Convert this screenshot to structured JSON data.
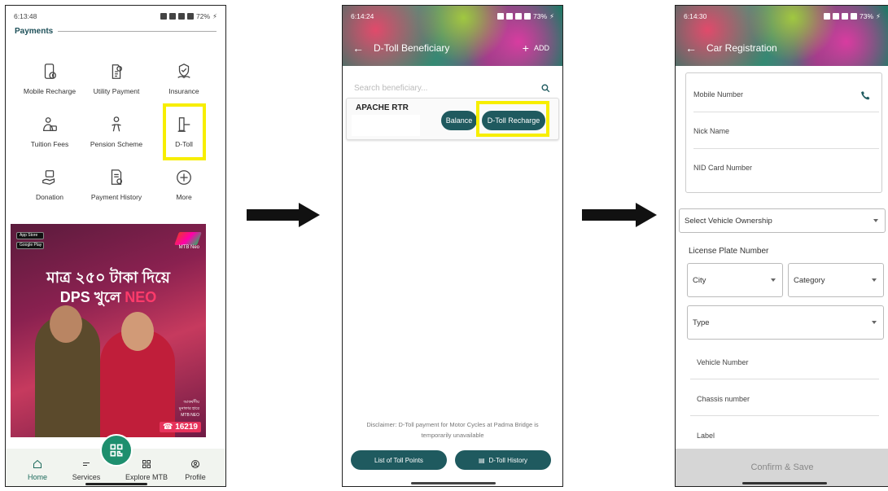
{
  "screen1": {
    "status_time": "6:13:48",
    "status_battery": "72%",
    "section_title": "Payments",
    "items": [
      {
        "label": "Mobile Recharge",
        "icon": "mobile-recharge-icon"
      },
      {
        "label": "Utility Payment",
        "icon": "utility-payment-icon"
      },
      {
        "label": "Insurance",
        "icon": "insurance-icon"
      },
      {
        "label": "Tuition Fees",
        "icon": "tuition-fees-icon"
      },
      {
        "label": "Pension Scheme",
        "icon": "pension-scheme-icon"
      },
      {
        "label": "D-Toll",
        "icon": "d-toll-icon"
      },
      {
        "label": "Donation",
        "icon": "donation-icon"
      },
      {
        "label": "Payment History",
        "icon": "payment-history-icon"
      },
      {
        "label": "More",
        "icon": "plus-circle-icon"
      }
    ],
    "banner": {
      "app_store": "App Store",
      "google_play": "Google Play",
      "brand": "MTB Neo",
      "line1": "মাত্র ২৫০ টাকা দিয়ে",
      "line2_prefix": "DPS খুলে ",
      "line2_highlight": "NEO",
      "hotline": "16219",
      "offer": "আকর্ষণীয় মুনাফার হারে MTB NEO"
    },
    "nav": [
      {
        "label": "Home",
        "icon": "home-icon"
      },
      {
        "label": "Services",
        "icon": "services-icon"
      },
      {
        "label": "Explore MTB",
        "icon": "explore-icon"
      },
      {
        "label": "Profile",
        "icon": "profile-icon"
      }
    ]
  },
  "screen2": {
    "status_time": "6:14:24",
    "status_battery": "73%",
    "title": "D-Toll Beneficiary",
    "add_label": "ADD",
    "search_placeholder": "Search beneficiary...",
    "beneficiary_name": "APACHE RTR",
    "balance_label": "Balance",
    "recharge_label": "D-Toll Recharge",
    "disclaimer": "Disclaimer: D-Toll payment for Motor Cycles at Padma Bridge is temporarily unavailable",
    "toll_points_label": "List of Toll Points",
    "history_label": "D-Toll History"
  },
  "screen3": {
    "status_time": "6:14:30",
    "status_battery": "73%",
    "title": "Car Registration",
    "mobile_number": "Mobile Number",
    "nick_name": "Nick Name",
    "nid_card": "NID Card Number",
    "vehicle_ownership": "Select Vehicle Ownership",
    "license_plate": "License Plate Number",
    "city": "City",
    "category": "Category",
    "type": "Type",
    "vehicle_number": "Vehicle Number",
    "chassis_number": "Chassis number",
    "label": "Label",
    "confirm": "Confirm & Save"
  },
  "colors": {
    "highlight": "#f7ee00",
    "primary": "#1f5a5f",
    "accent": "#1e8f6e"
  }
}
